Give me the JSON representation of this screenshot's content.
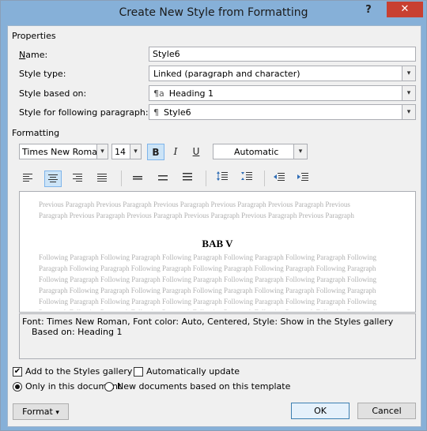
{
  "window": {
    "title": "Create New Style from Formatting",
    "help_label": "?",
    "close_label": "✕"
  },
  "properties": {
    "section_label": "Properties",
    "name_label": "Name:",
    "name_value": "Style6",
    "style_type_label": "Style type:",
    "style_type_value": "Linked (paragraph and character)",
    "based_on_label": "Style based on:",
    "based_on_icon": "¶a",
    "based_on_value": "Heading 1",
    "following_label": "Style for following paragraph:",
    "following_icon": "¶",
    "following_value": "Style6"
  },
  "formatting": {
    "section_label": "Formatting",
    "font_value": "Times New Roman",
    "size_value": "14",
    "bold_label": "B",
    "italic_label": "I",
    "underline_label": "U",
    "color_value": "Automatic"
  },
  "preview": {
    "previous_text": "Previous Paragraph Previous Paragraph Previous Paragraph Previous Paragraph Previous Paragraph Previous Paragraph Previous Paragraph Previous Paragraph Previous Paragraph Previous Paragraph Previous Paragraph Previous Paragraph Previous Paragraph Previous Paragraph Previous Paragraph Previous Paragraph Previous Paragraph Previous Paragraph Previous Paragraph Previous Paragraph Previous Paragraph Previous Paragraph Previous Paragraph Previous Paragraph Previous Paragraph Previous Paragraph Previous Paragraph Previous Paragraph Previous Paragraph Previous Paragraph Previous Paragraph Previous Paragraph Previous Paragraph",
    "sample_text": "BAB V",
    "following_text": "Following Paragraph Following Paragraph Following Paragraph Following Paragraph Following Paragraph Following Paragraph Following Paragraph Following Paragraph Following Paragraph Following Paragraph Following Paragraph Following Paragraph Following Paragraph Following Paragraph Following Paragraph Following Paragraph Following Paragraph Following Paragraph Following Paragraph Following Paragraph Following Paragraph Following Paragraph Following Paragraph Following Paragraph Following Paragraph Following Paragraph Following Paragraph Following Paragraph Following Paragraph Following Paragraph Following Paragraph Following Paragraph Following Paragraph Following Paragraph Following Paragraph Following Paragraph Following Paragraph Following Paragraph Following Paragraph Following Paragraph Following Paragraph Following Paragraph Following Paragraph Following Paragraph Following Paragraph"
  },
  "description": {
    "line1": "Font: Times New Roman, Font color: Auto, Centered, Style: Show in the Styles gallery",
    "line2": "Based on: Heading 1"
  },
  "options": {
    "add_to_gallery_label": "Add to the Styles gallery",
    "add_to_gallery_checked": true,
    "auto_update_label": "Automatically update",
    "auto_update_checked": false,
    "only_this_doc_label": "Only in this document",
    "new_docs_label": "New documents based on this template",
    "check_mark": "✔"
  },
  "buttons": {
    "format_label": "Format",
    "format_arrow": "▾",
    "ok_label": "OK",
    "cancel_label": "Cancel"
  },
  "icons": {
    "dropdown_arrow": "▾"
  },
  "colors": {
    "title_bar": "#86b0d8",
    "close_button": "#c84031",
    "active_toggle": "#cce4f7"
  }
}
